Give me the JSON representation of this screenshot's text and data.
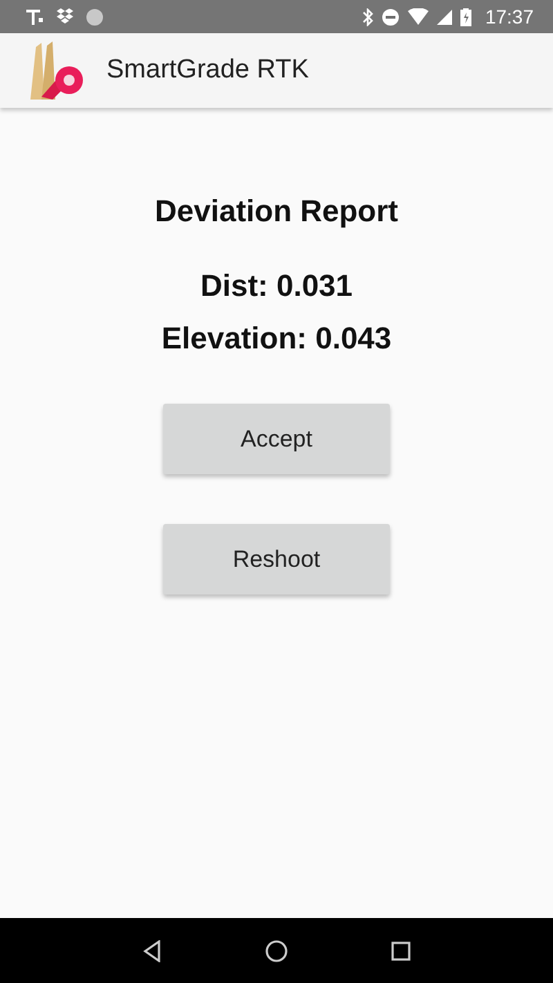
{
  "status_bar": {
    "time": "17:37"
  },
  "app_bar": {
    "title": "SmartGrade RTK"
  },
  "report": {
    "title": "Deviation Report",
    "lines": [
      "Dist: 0.031",
      "Elevation: 0.043"
    ]
  },
  "buttons": [
    "Accept",
    "Reshoot"
  ]
}
